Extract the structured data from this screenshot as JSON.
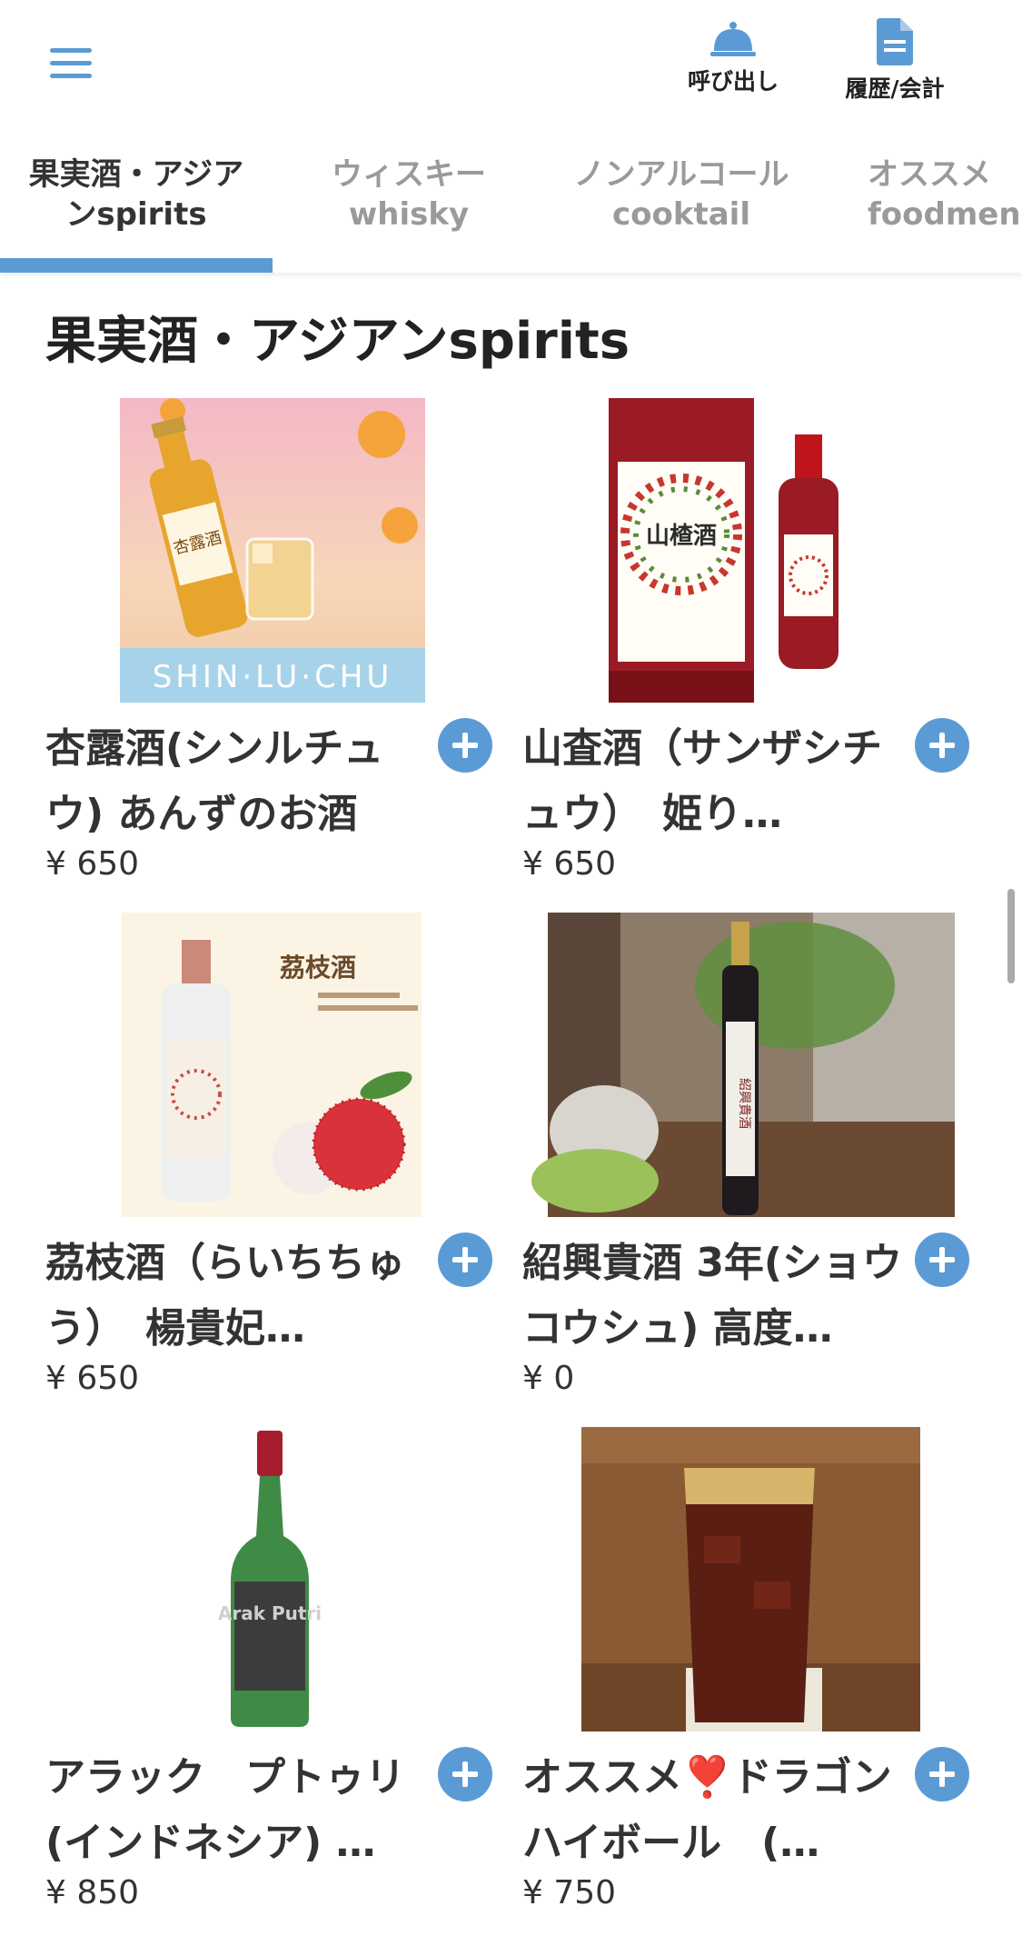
{
  "header": {
    "call_label": "呼び出し",
    "history_label": "履歴/会計"
  },
  "tabs": [
    {
      "line1": "果実酒・アジア",
      "line2": "ンspirits",
      "active": true
    },
    {
      "line1": "ウィスキー",
      "line2": "whisky",
      "active": false
    },
    {
      "line1": "ノンアルコール",
      "line2": "cooktail",
      "active": false
    },
    {
      "line1": "オススメ",
      "line2": "foodmenu",
      "active": false
    }
  ],
  "section_title": "果実酒・アジアンspirits",
  "products": [
    {
      "name": "杏露酒(シンルチュウ) あんずのお酒",
      "price": "¥ 650",
      "image": "apricot-liqueur-photo"
    },
    {
      "name": "山査酒（サンザシチュウ）　姫り…",
      "price": "¥ 650",
      "image": "hawthorn-liqueur-photo"
    },
    {
      "name": "茘枝酒（らいちちゅう）　楊貴妃…",
      "price": "¥ 650",
      "image": "lychee-liqueur-photo"
    },
    {
      "name": "紹興貴酒 3年(ショウコウシュ) 高度…",
      "price": "¥ 0",
      "image": "shaoxing-wine-photo"
    },
    {
      "name": "アラック　プトゥリ(インドネシア) …",
      "price": "¥ 850",
      "image": "arak-putri-bottle-photo"
    },
    {
      "name": "オススメ❣️ドラゴンハイボール　(…",
      "price": "¥ 750",
      "image": "dragon-highball-photo"
    }
  ],
  "image_texts": {
    "apricot_banner": "SHIN·LU·CHU",
    "apricot_label": "杏露酒",
    "hawthorn_label": "山楂酒",
    "lychee_label": "茘枝酒",
    "shaoxing_label": "紹興貴酒",
    "arak_label": "Arak Putri"
  },
  "colors": {
    "accent": "#5b9bd5",
    "text": "#333333",
    "inactive_tab": "#9a9a9a"
  }
}
